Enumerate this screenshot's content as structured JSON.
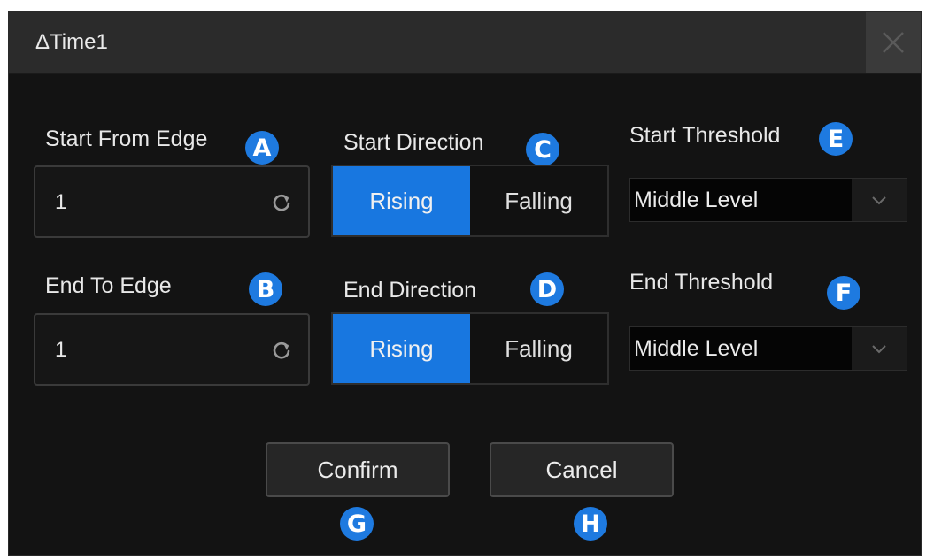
{
  "dialog": {
    "title": "ΔTime1",
    "close_icon": "close-icon"
  },
  "start_from_edge": {
    "label": "Start From Edge",
    "badge": "A",
    "value": "1",
    "icon": "refresh-icon"
  },
  "end_to_edge": {
    "label": "End To Edge",
    "badge": "B",
    "value": "1",
    "icon": "refresh-icon"
  },
  "start_direction": {
    "label": "Start Direction",
    "badge": "C",
    "options": [
      "Rising",
      "Falling"
    ],
    "selected": "Rising"
  },
  "end_direction": {
    "label": "End Direction",
    "badge": "D",
    "options": [
      "Rising",
      "Falling"
    ],
    "selected": "Rising"
  },
  "start_threshold": {
    "label": "Start Threshold",
    "badge": "E",
    "value": "Middle Level",
    "icon": "chevron-down-icon"
  },
  "end_threshold": {
    "label": "End Threshold",
    "badge": "F",
    "value": "Middle Level",
    "icon": "chevron-down-icon"
  },
  "confirm": {
    "label": "Confirm",
    "badge": "G"
  },
  "cancel": {
    "label": "Cancel",
    "badge": "H"
  },
  "colors": {
    "accent": "#1877e0",
    "badge": "#1e7ae0",
    "background": "#131313",
    "titlebar": "#2b2b2b"
  }
}
